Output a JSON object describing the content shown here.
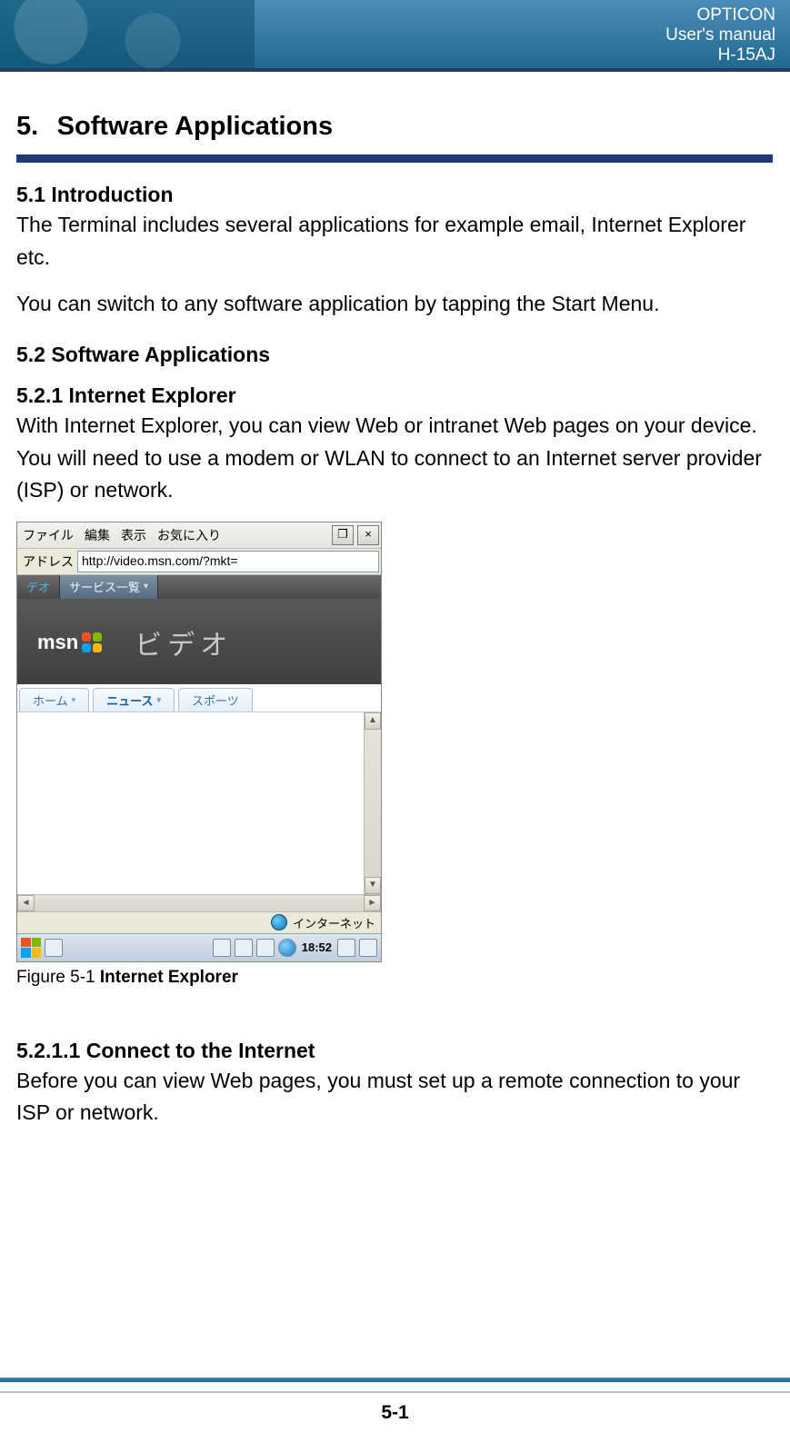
{
  "header": {
    "line1": "OPTICON",
    "line2": "User's manual",
    "line3": "H-15AJ"
  },
  "section": {
    "number": "5.",
    "title": "Software Applications",
    "sub1_heading": "5.1 Introduction",
    "sub1_p1": "The Terminal includes several applications for example email, Internet Explorer etc.",
    "sub1_p2": "You can switch to any software application by tapping the Start Menu.",
    "sub2_heading": "5.2 Software Applications",
    "sub21_heading": "5.2.1 Internet Explorer",
    "sub21_p": "With Internet Explorer, you can view Web or intranet Web pages on your device. You will need to use a modem or WLAN to connect to an Internet server provider (ISP) or network.",
    "figure_caption_prefix": "Figure 5-1 ",
    "figure_caption_bold": "Internet Explorer",
    "sub211_heading": "5.2.1.1 Connect to the Internet",
    "sub211_p": "Before you can view Web pages, you must set up a remote connection to your ISP or network."
  },
  "screenshot": {
    "menus": [
      "ファイル",
      "編集",
      "表示",
      "お気に入り"
    ],
    "restore_glyph": "❐",
    "close_glyph": "×",
    "address_label": "アドレス",
    "address_value": "http://video.msn.com/?mkt=",
    "toptabs": {
      "left": "デオ",
      "active": "サービス一覧"
    },
    "msn_label": "msn",
    "hero_label": "ビデオ",
    "subtabs": [
      "ホーム",
      "ニュース",
      "スポーツ"
    ],
    "status_label": "インターネット",
    "clock": "18:52"
  },
  "footer": {
    "page": "5-1"
  }
}
